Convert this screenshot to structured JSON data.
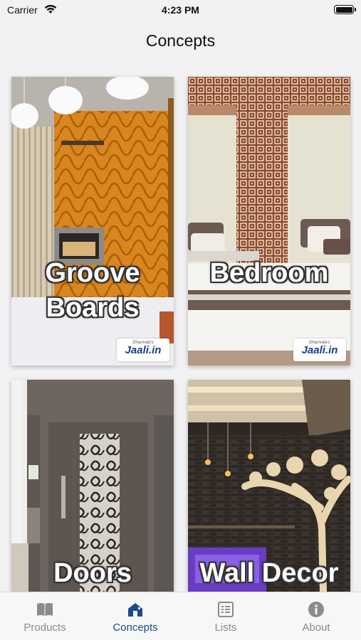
{
  "status": {
    "carrier": "Carrier",
    "time": "4:23 PM"
  },
  "nav": {
    "title": "Concepts"
  },
  "cards": [
    {
      "label_line1": "Groove",
      "label_line2": "Boards",
      "logo_sub": "Dharivala's",
      "logo_main": "Jaali.in"
    },
    {
      "label_line1": "Bedroom",
      "logo_sub": "Dharivala's",
      "logo_main": "Jaali.in"
    },
    {
      "label_line1": "Doors"
    },
    {
      "label_line1": "Wall Decor"
    }
  ],
  "tabs": [
    {
      "label": "Products",
      "icon": "book-icon"
    },
    {
      "label": "Concepts",
      "icon": "house-icon",
      "active": true
    },
    {
      "label": "Lists",
      "icon": "list-icon"
    },
    {
      "label": "About",
      "icon": "info-icon"
    }
  ],
  "colors": {
    "accent": "#1f4a8c",
    "inactive": "#8a8a8f"
  }
}
